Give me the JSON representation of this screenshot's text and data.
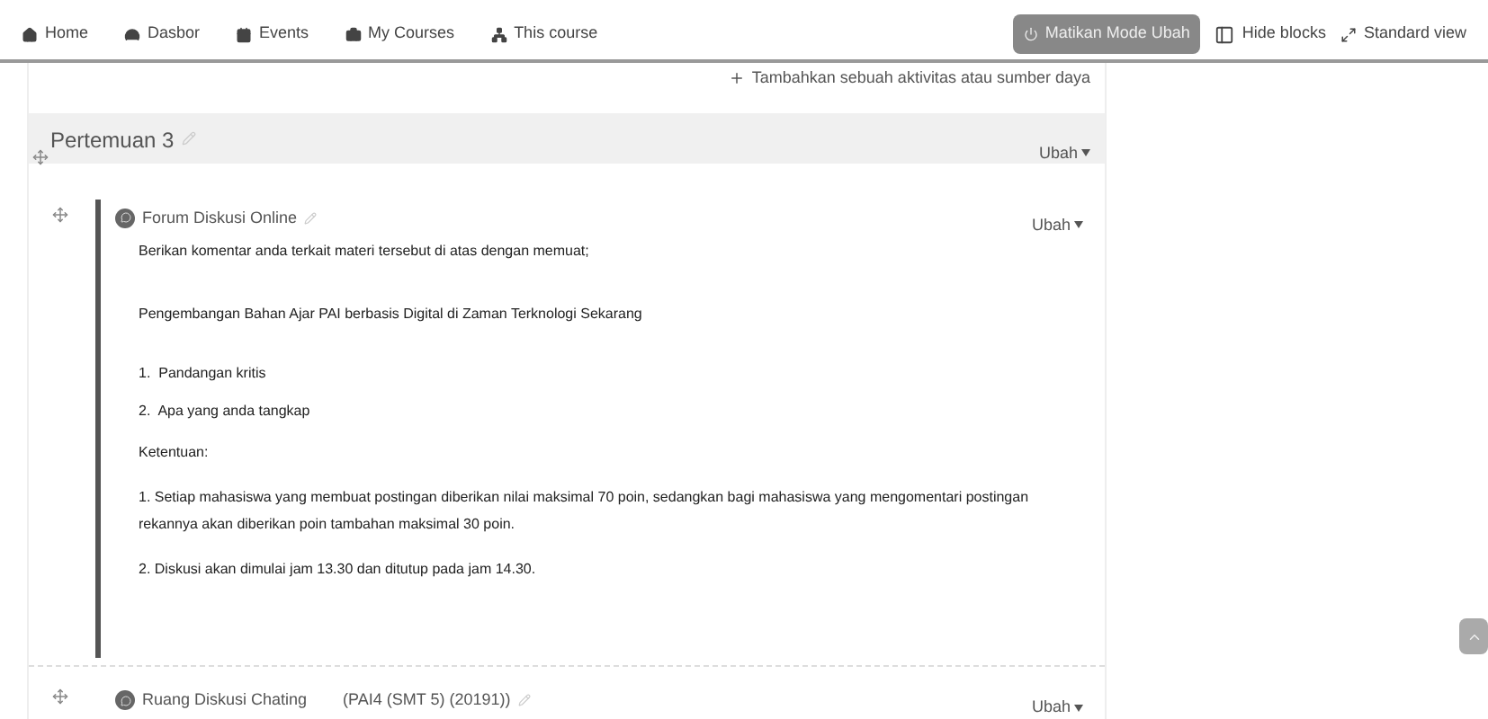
{
  "navbar": {
    "items": [
      {
        "label": "Home"
      },
      {
        "label": "Dasbor"
      },
      {
        "label": "Events"
      },
      {
        "label": "My Courses"
      },
      {
        "label": "This course"
      }
    ],
    "edit_mode_button": "Matikan Mode Ubah",
    "hide_blocks": "Hide blocks",
    "standard_view": "Standard view"
  },
  "add_activity": "Tambahkan sebuah aktivitas atau sumber daya",
  "section": {
    "title": "Pertemuan 3",
    "edit_menu": "Ubah"
  },
  "activities": [
    {
      "title": "Forum Diskusi Online",
      "edit_menu": "Ubah",
      "body": [
        {
          "kind": "para",
          "text": "Berikan komentar anda terkait materi tersebut di atas dengan memuat;"
        },
        {
          "kind": "gap"
        },
        {
          "kind": "para",
          "text": "Pengembangan Bahan Ajar PAI berbasis Digital di Zaman Terknologi Sekarang"
        },
        {
          "kind": "gap"
        },
        {
          "kind": "item",
          "marker": "1.",
          "text": "Pandangan kritis"
        },
        {
          "kind": "item",
          "marker": "2.",
          "text": "Apa yang anda tangkap"
        },
        {
          "kind": "para",
          "text": "Ketentuan:"
        },
        {
          "kind": "para",
          "text": "1. Setiap mahasiswa yang membuat postingan diberikan nilai maksimal 70 poin, sedangkan bagi mahasiswa yang mengomentari postingan rekannya akan diberikan poin tambahan maksimal 30 poin."
        },
        {
          "kind": "para",
          "text": "2. Diskusi akan dimulai jam 13.30 dan ditutup pada jam 14.30."
        }
      ]
    },
    {
      "title": "Ruang Diskusi Chating",
      "subtitle": "(PAI4 (SMT 5) (20191))",
      "edit_menu": "Ubah"
    }
  ]
}
